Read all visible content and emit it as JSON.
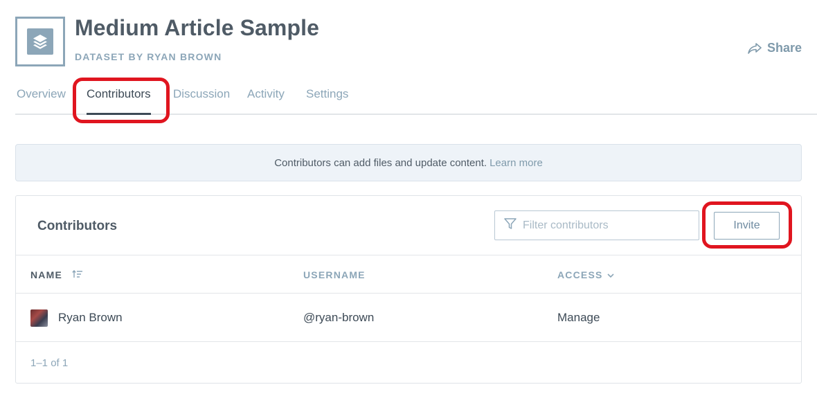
{
  "dataset": {
    "title": "Medium Article Sample",
    "subtitle": "DATASET BY RYAN BROWN",
    "icon": "layers-icon"
  },
  "share": {
    "label": "Share",
    "icon": "share-arrow-icon"
  },
  "tabs": [
    {
      "label": "Overview",
      "active": false
    },
    {
      "label": "Contributors",
      "active": true
    },
    {
      "label": "Discussion",
      "active": false
    },
    {
      "label": "Activity",
      "active": false
    },
    {
      "label": "Settings",
      "active": false
    }
  ],
  "notice": {
    "text": "Contributors can add files and update content.",
    "link": "Learn more"
  },
  "contributors": {
    "title": "Contributors",
    "filter_placeholder": "Filter contributors",
    "filter_value": "",
    "invite_label": "Invite",
    "columns": {
      "name": "NAME",
      "username": "USERNAME",
      "access": "ACCESS"
    },
    "rows": [
      {
        "name": "Ryan Brown",
        "username": "@ryan-brown",
        "access": "Manage"
      }
    ],
    "pagination": "1–1 of 1"
  },
  "colors": {
    "accent": "#8ca6b8",
    "text": "#3d4a56",
    "annotation": "#e0151f",
    "notice_bg": "#eef3f8"
  }
}
